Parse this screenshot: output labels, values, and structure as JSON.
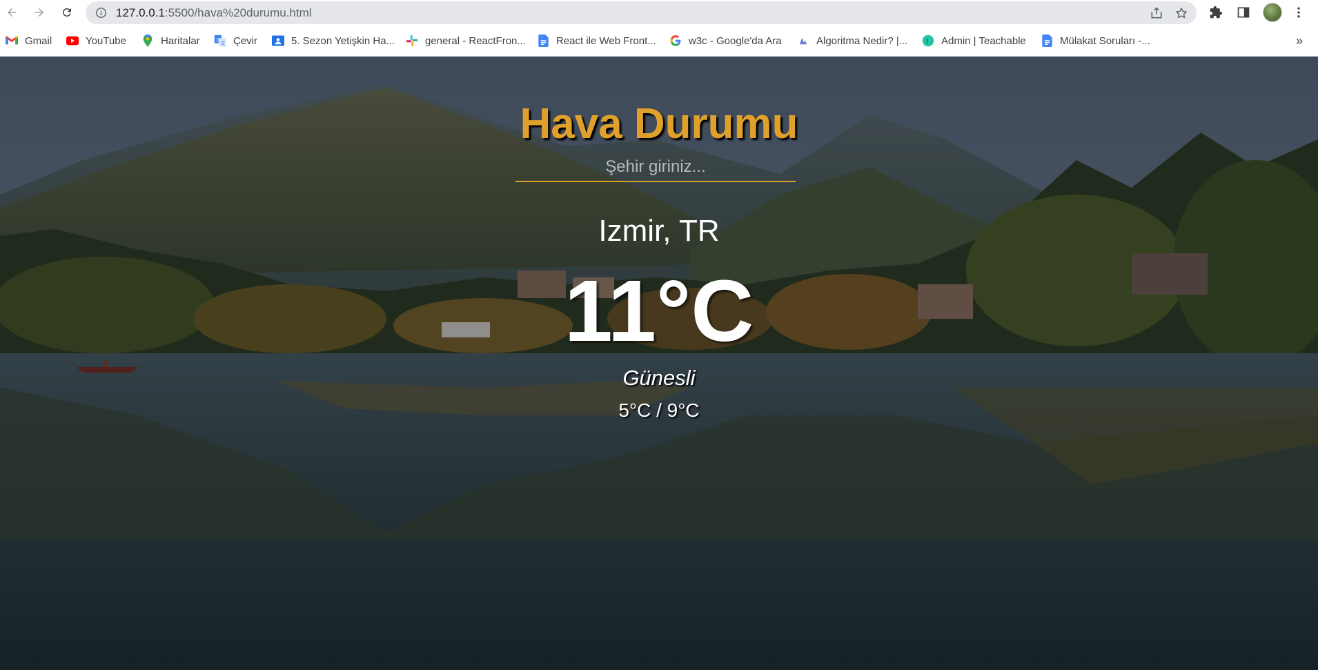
{
  "browser": {
    "url_host": "127.0.0.1",
    "url_path": ":5500/hava%20durumu.html",
    "bookmarks": [
      {
        "label": "Gmail",
        "icon": "gmail-icon"
      },
      {
        "label": "YouTube",
        "icon": "youtube-icon"
      },
      {
        "label": "Haritalar",
        "icon": "maps-icon"
      },
      {
        "label": "Çevir",
        "icon": "translate-icon"
      },
      {
        "label": "5. Sezon Yetişkin Ha...",
        "icon": "classroom-icon"
      },
      {
        "label": "general - ReactFron...",
        "icon": "slack-icon"
      },
      {
        "label": "React ile Web Front...",
        "icon": "docs-icon"
      },
      {
        "label": "w3c - Google'da Ara",
        "icon": "google-icon"
      },
      {
        "label": "Algoritma Nedir? |...",
        "icon": "site-icon"
      },
      {
        "label": "Admin | Teachable",
        "icon": "teachable-icon"
      },
      {
        "label": "Mülakat Soruları -...",
        "icon": "docs-icon"
      }
    ],
    "more_label": "»"
  },
  "app": {
    "title": "Hava Durumu",
    "search_placeholder": "Şehir giriniz...",
    "city": "Izmir, TR",
    "temperature": "11°C",
    "description": "Günesli",
    "min_max": "5°C / 9°C"
  },
  "colors": {
    "accent": "#e0a12c",
    "text": "#ffffff"
  }
}
